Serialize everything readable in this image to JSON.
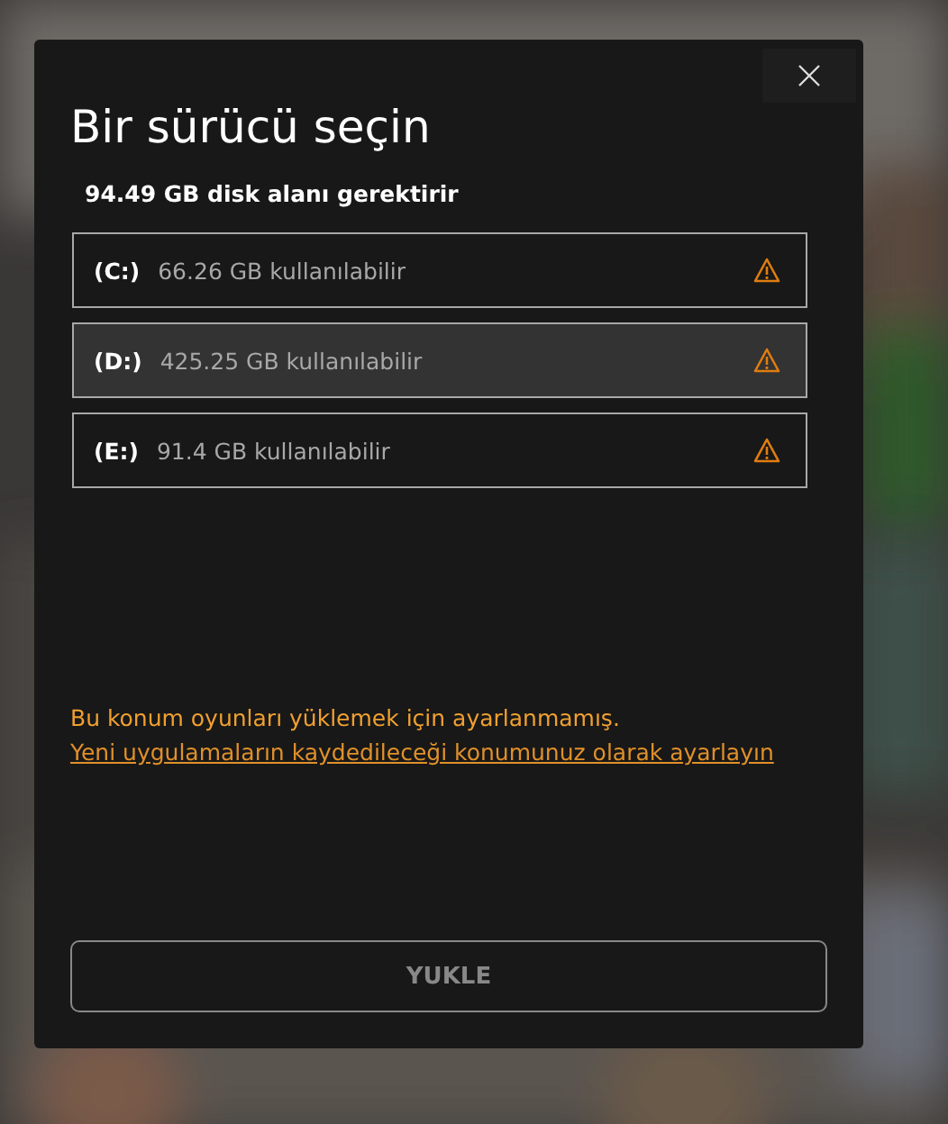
{
  "dialog": {
    "title": "Bir sürücü seçin",
    "requirement": "94.49 GB disk alanı gerektirir",
    "drives": [
      {
        "letter": "(C:)",
        "space": "66.26 GB kullanılabilir",
        "selected": false,
        "warning": true
      },
      {
        "letter": "(D:)",
        "space": "425.25 GB kullanılabilir",
        "selected": true,
        "warning": true
      },
      {
        "letter": "(E:)",
        "space": "91.4 GB kullanılabilir",
        "selected": false,
        "warning": true
      }
    ],
    "warning_text": "Bu konum oyunları yüklemek için ayarlanmamış.",
    "warning_link": "Yeni uygulamaların kaydedileceği konumunuz olarak ayarlayın",
    "install_button": {
      "label": "YUKLE",
      "disabled": true
    }
  }
}
